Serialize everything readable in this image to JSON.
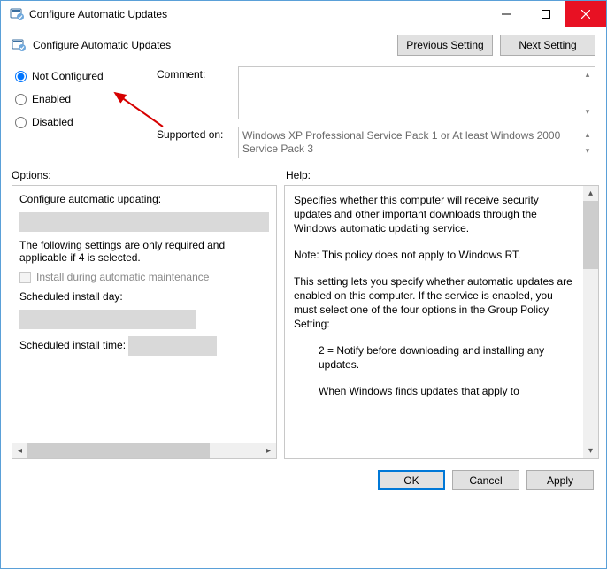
{
  "window": {
    "title": "Configure Automatic Updates"
  },
  "header": {
    "title": "Configure Automatic Updates",
    "prev_label_pre": "P",
    "prev_label_post": "revious Setting",
    "next_label_pre": "N",
    "next_label_post": "ext Setting"
  },
  "radios": {
    "not_configured_pre": "Not ",
    "not_configured_u": "C",
    "not_configured_post": "onfigured",
    "enabled_u": "E",
    "enabled_post": "nabled",
    "disabled_u": "D",
    "disabled_post": "isabled",
    "selected": "not_configured"
  },
  "comment": {
    "label": "Comment:",
    "value": ""
  },
  "supported": {
    "label": "Supported on:",
    "text": "Windows XP Professional Service Pack 1 or At least Windows 2000 Service Pack 3"
  },
  "labels": {
    "options": "Options:",
    "help": "Help:"
  },
  "options": {
    "configure_label": "Configure automatic updating:",
    "configure_value": "",
    "following_note": "The following settings are only required and applicable if 4 is selected.",
    "install_during": "Install during automatic maintenance",
    "install_day_label": "Scheduled install day:",
    "install_day_value": "",
    "install_time_label": "Scheduled install time:",
    "install_time_value": ""
  },
  "help": {
    "p1": "Specifies whether this computer will receive security updates and other important downloads through the Windows automatic updating service.",
    "p2": "Note: This policy does not apply to Windows RT.",
    "p3": "This setting lets you specify whether automatic updates are enabled on this computer. If the service is enabled, you must select one of the four options in the Group Policy Setting:",
    "p4": "2 = Notify before downloading and installing any updates.",
    "p5": "When Windows finds updates that apply to"
  },
  "buttons": {
    "ok": "OK",
    "cancel": "Cancel",
    "apply": "Apply"
  }
}
